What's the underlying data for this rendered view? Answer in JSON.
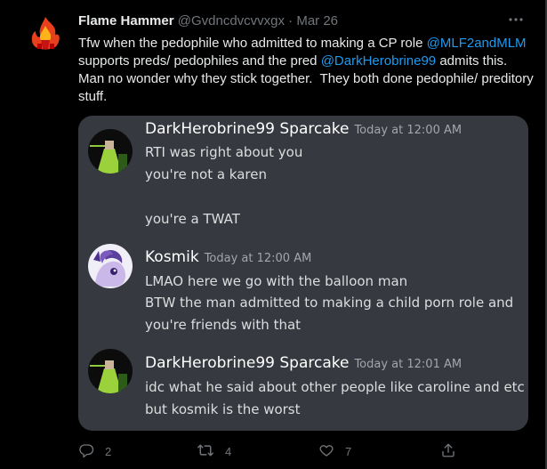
{
  "tweet": {
    "display_name": "Flame Hammer",
    "handle": "@Gvdncdvcvvxgx",
    "separator": "·",
    "date": "Mar 26",
    "text_1": "Tfw when the pedophile who admitted to making a CP role ",
    "mention_1": "@MLF2andMLM",
    "text_2": " supports preds/ pedophiles and the pred ",
    "mention_2": "@DarkHerobrine99",
    "text_3": " admits this. Man no wonder why they stick together.  They both done pedophile/ preditory stuff.",
    "accent_color": "#1d9bf0"
  },
  "discord": {
    "messages": [
      {
        "author": "DarkHerobrine99 Sparcake",
        "timestamp": "Today at 12:00 AM",
        "lines": [
          "RTI was right about you",
          "you're not a karen",
          "",
          "you're a TWAT"
        ]
      },
      {
        "author": "Kosmik",
        "timestamp": "Today at 12:00 AM",
        "lines": [
          "LMAO here we go with the balloon man",
          "BTW the man admitted to making a child porn role and",
          "you're friends with that"
        ]
      },
      {
        "author": "DarkHerobrine99 Sparcake",
        "timestamp": "Today at 12:01 AM",
        "lines": [
          "idc what he said about other people like caroline and etc",
          "but kosmik is the worst"
        ]
      }
    ]
  },
  "actions": {
    "reply_icon": "reply-icon",
    "reply_count": "2",
    "retweet_icon": "retweet-icon",
    "retweet_count": "4",
    "like_icon": "like-icon",
    "like_count": "7",
    "share_icon": "share-icon"
  }
}
